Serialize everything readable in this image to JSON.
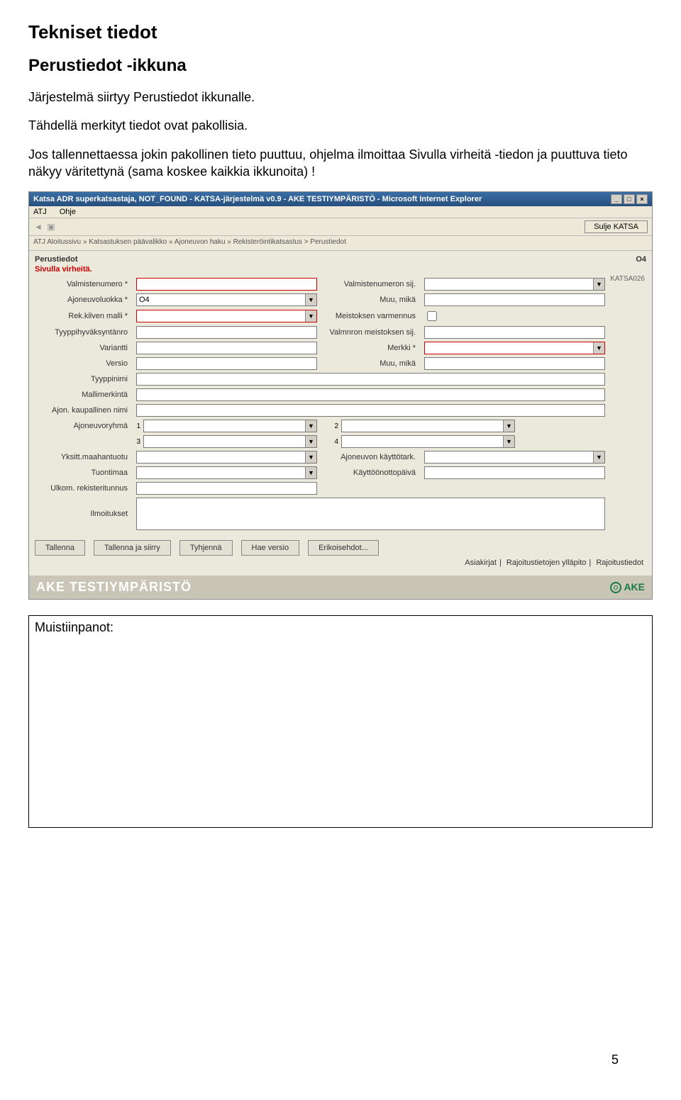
{
  "doc": {
    "h1": "Tekniset tiedot",
    "h2": "Perustiedot -ikkuna",
    "p1": "Järjestelmä siirtyy Perustiedot ikkunalle.",
    "p2": "Tähdellä merkityt tiedot ovat pakollisia.",
    "p3": "Jos tallennettaessa jokin pakollinen tieto puuttuu, ohjelma ilmoittaa Sivulla virheitä -tiedon ja puuttuva tieto näkyy väritettynä (sama koskee kaikkia ikkunoita) !",
    "notes_label": "Muistiinpanot:",
    "page_number": "5"
  },
  "win": {
    "title": "Katsa ADR superkatsastaja, NOT_FOUND - KATSA-järjestelmä v0.9 - AKE TESTIYMPÄRISTÖ - Microsoft Internet Explorer",
    "menu_atj": "ATJ",
    "menu_ohje": "Ohje",
    "sulje": "Sulje KATSA",
    "breadcrumb": "ATJ Aloitussivu » Katsastuksen päävalikko » Ajoneuvon haku » Rekisteröintikatsastus > Perustiedot",
    "panel_title": "Perustiedot",
    "o4": "O4",
    "error": "Sivulla virheitä.",
    "code": "KATSA026",
    "env": "AKE TESTIYMPÄRISTÖ",
    "ake": "AKE"
  },
  "labels": {
    "valmistenumero": "Valmistenumero *",
    "valmistenumeron_sij": "Valmistenumeron sij.",
    "ajoneuvoluokka": "Ajoneuvoluokka *",
    "muu_mika_1": "Muu, mikä",
    "rek_kilven_malli": "Rek.kilven malli *",
    "meistoksen_varmennus": "Meistoksen varmennus",
    "tyyppihyvaksyntanro": "Tyyppihyväksyntänro",
    "valmnron_meistoksen_sij": "Valmnron meistoksen sij.",
    "variantti": "Variantti",
    "merkki": "Merkki *",
    "versio": "Versio",
    "muu_mika_2": "Muu, mikä",
    "tyyppinimi": "Tyyppinimi",
    "mallimerkinta": "Mallimerkintä",
    "ajon_kaupallinen_nimi": "Ajon. kaupallinen nimi",
    "ajoneuvoryhma": "Ajoneuvoryhmä",
    "num1": "1",
    "num2": "2",
    "num3": "3",
    "num4": "4",
    "yksitt_maahantuotu": "Yksitt.maahantuotu",
    "ajoneuvon_kayttotark": "Ajoneuvon käyttötark.",
    "tuontimaa": "Tuontimaa",
    "kayttoonottopaiva": "Käyttöönottopäivä",
    "ulkom_rekisteritunnus": "Ulkom. rekisteritunnus",
    "ilmoitukset": "Ilmoitukset"
  },
  "values": {
    "ajoneuvoluokka": "O4"
  },
  "buttons": {
    "tallenna": "Tallenna",
    "tallenna_siirry": "Tallenna ja siirry",
    "tyhjenna": "Tyhjennä",
    "hae_versio": "Hae versio",
    "erikoisehdot": "Erikoisehdot..."
  },
  "bottom_links": {
    "a1": "Asiakirjat",
    "a2": "Rajoitustietojen ylläpito",
    "a3": "Rajoitustiedot"
  }
}
